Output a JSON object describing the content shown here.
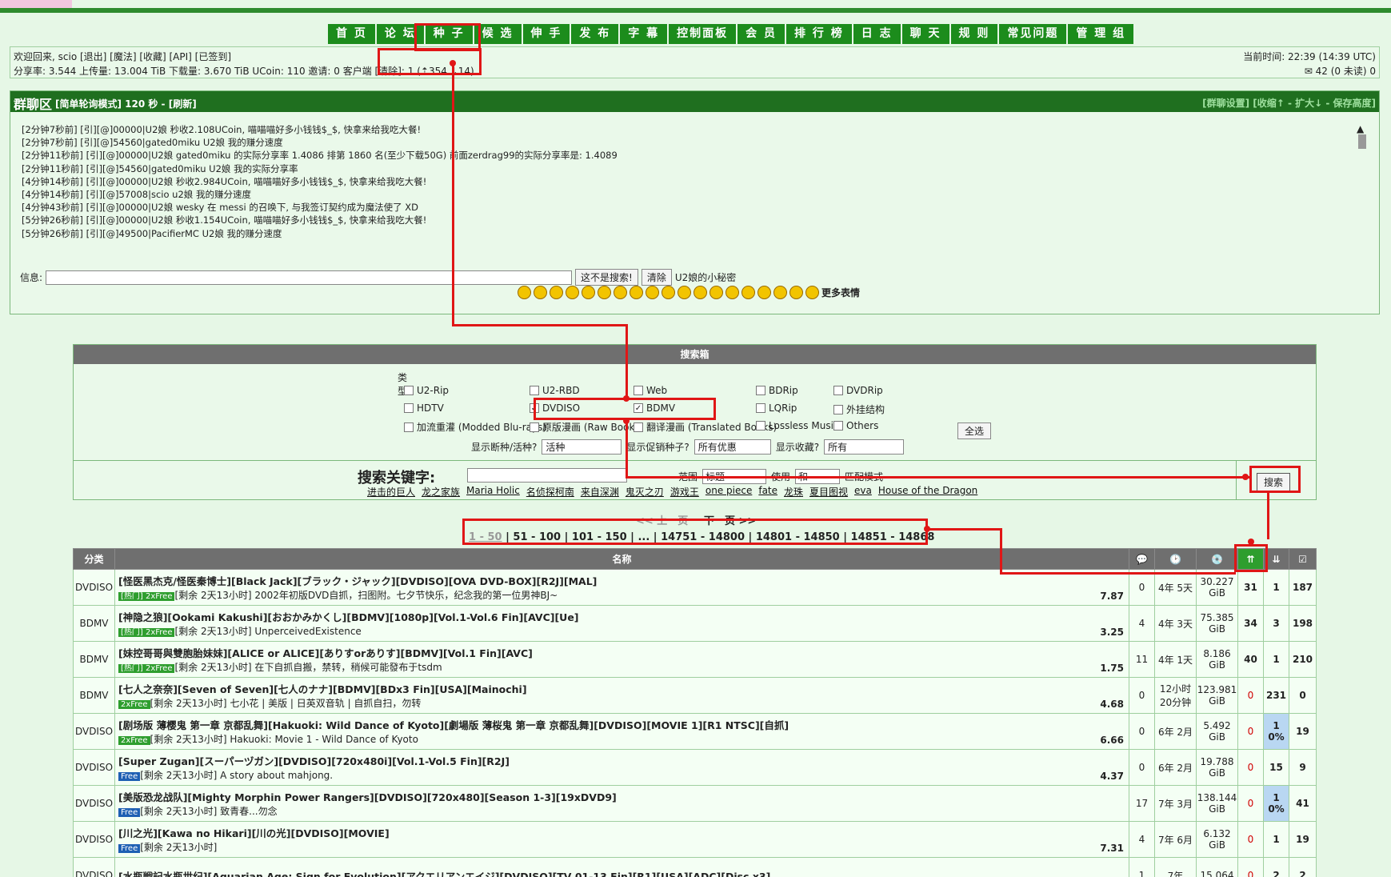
{
  "nav": [
    "首 页",
    "论 坛",
    "种 子",
    "候 选",
    "伸 手",
    "发 布",
    "字 幕",
    "控制面板",
    "会 员",
    "排 行 榜",
    "日 志",
    "聊 天",
    "规 则",
    "常见问题",
    "管 理 组"
  ],
  "userbar": {
    "line1": "欢迎回来, scio [退出] [魔法] [收藏] [API] [已签到]",
    "line2": "分享率: 3.544  上传量: 13.004 TiB  下载量: 3.670 TiB  UCoin: 110  邀请: 0  客户端 [清除]: 1 (⇡354 ⇣14)",
    "time": "当前时间: 22:39 (14:39 UTC)",
    "msgs": "42 (0 未读)  0"
  },
  "chat": {
    "title": "群聊区",
    "mode": "[简单轮询模式] 120 秒 - [刷新]",
    "right": "[群聊设置] [收缩↑ - 扩大↓ - 保存高度]",
    "messages": [
      "[2分钟7秒前] [引][@]00000|U2娘 秒收2.108UCoin, 喵喵喵好多小钱钱$_$, 快拿来给我吃大餐!",
      "[2分钟7秒前] [引][@]54560|gated0miku U2娘 我的赚分速度",
      "[2分钟11秒前] [引][@]00000|U2娘 gated0miku 的实际分享率 1.4086 排第 1860 名(至少下载50G)  前面zerdrag99的实际分享率是: 1.4089",
      "[2分钟11秒前] [引][@]54560|gated0miku U2娘 我的实际分享率",
      "[4分钟14秒前] [引][@]00000|U2娘 秒收2.984UCoin, 喵喵喵好多小钱钱$_$, 快拿来给我吃大餐!",
      "[4分钟14秒前] [引][@]57008|scio u2娘 我的赚分速度",
      "[4分钟43秒前] [引][@]00000|U2娘 wesky 在 messi 的召唤下, 与我签订契约成为魔法使了 XD",
      "[5分钟26秒前] [引][@]00000|U2娘 秒收1.154UCoin, 喵喵喵好多小钱钱$_$, 快拿来给我吃大餐!",
      "[5分钟26秒前] [引][@]49500|PacifierMC U2娘 我的赚分速度"
    ],
    "info_label": "信息:",
    "btn_not_search": "这不是搜索!",
    "btn_clear": "清除",
    "secret": "U2娘的小秘密",
    "more_emoji": "更多表情"
  },
  "search": {
    "header": "搜索箱",
    "type_label": "类型:",
    "types": [
      {
        "label": "U2-Rip",
        "checked": false
      },
      {
        "label": "U2-RBD",
        "checked": false
      },
      {
        "label": "Web",
        "checked": false
      },
      {
        "label": "BDRip",
        "checked": false
      },
      {
        "label": "DVDRip",
        "checked": false
      },
      {
        "label": "HDTV",
        "checked": false
      },
      {
        "label": "DVDISO",
        "checked": true
      },
      {
        "label": "BDMV",
        "checked": true
      },
      {
        "label": "LQRip",
        "checked": false
      },
      {
        "label": "外挂结构",
        "checked": false
      },
      {
        "label": "加流重灌 (Modded Blu-rays)",
        "checked": false
      },
      {
        "label": "原版漫画 (Raw Books)",
        "checked": false
      },
      {
        "label": "翻译漫画 (Translated Books)",
        "checked": false
      },
      {
        "label": "Lossless Music",
        "checked": false
      },
      {
        "label": "Others",
        "checked": false
      }
    ],
    "select_all": "全选",
    "show_dead": "显示断种/活种?",
    "dead_val": "活种",
    "show_promo": "显示促销种子?",
    "promo_val": "所有优惠",
    "show_fav": "显示收藏?",
    "fav_val": "所有",
    "keyword_label": "搜索关键字:",
    "range_label": "范围",
    "range_val": "标题",
    "use_label": "使用",
    "use_val": "和",
    "match_label": "匹配模式",
    "search_btn": "搜索",
    "hot": [
      "进击的巨人",
      "龙之家族",
      "Maria Holic",
      "名侦探柯南",
      "来自深渊",
      "鬼灭之刃",
      "游戏王",
      "one piece",
      "fate",
      "龙珠",
      "夏目图视",
      "eva",
      "House of the Dragon"
    ]
  },
  "pager": {
    "prev": "<< 上一页",
    "next": "下一页 >>",
    "pages": [
      "1 - 50",
      "51 - 100",
      "101 - 150",
      "...",
      "14751 - 14800",
      "14801 - 14850",
      "14851 - 14868"
    ]
  },
  "table": {
    "headers": [
      "分类",
      "名称"
    ],
    "rows": [
      {
        "cat": "DVDISO",
        "title": "[怪医黑杰克/怪医秦博士][Black Jack][ブラック・ジャック][DVDISO][OVA DVD-BOX][R2J][MAL]",
        "tags": "[热门] 2xFree",
        "sub": "[剩余 2天13小时] 2002年初版DVD自抓，扫图附。七夕节快乐，纪念我的第一位男神BJ~",
        "rating": "7.87",
        "comments": "0",
        "age": "4年 5天",
        "size": "30.227 GiB",
        "seed": "31",
        "leech": "1",
        "done": "187"
      },
      {
        "cat": "BDMV",
        "title": "[神隐之狼][Ookami Kakushi][おおかみかくし][BDMV][1080p][Vol.1-Vol.6 Fin][AVC][Ue]",
        "tags": "[热门] 2xFree",
        "sub": "[剩余 2天13小时] UnperceivedExistence",
        "rating": "3.25",
        "comments": "4",
        "age": "4年 3天",
        "size": "75.385 GiB",
        "seed": "34",
        "leech": "3",
        "done": "198"
      },
      {
        "cat": "BDMV",
        "title": "[妹控哥哥與雙胞胎妹妹][ALICE or ALICE][ありすorありす][BDMV][Vol.1 Fin][AVC]",
        "tags": "[热门] 2xFree",
        "sub": "[剩余 2天13小时] 在下自抓自搬，禁转，稍候可能發布于tsdm",
        "rating": "1.75",
        "comments": "11",
        "age": "4年 1天",
        "size": "8.186 GiB",
        "seed": "40",
        "leech": "1",
        "done": "210"
      },
      {
        "cat": "BDMV",
        "title": "[七人之奈奈][Seven of Seven][七人のナナ][BDMV][BDx3 Fin][USA][Mainochi]",
        "tags": "2xFree",
        "sub": "[剩余 2天13小时] 七小花 | 美版 | 日英双音轨 | 自抓自扫，勿转",
        "rating": "4.68",
        "comments": "0",
        "age": "12小时 20分钟",
        "size": "123.981 GiB",
        "seed": "0",
        "leech": "231",
        "done": "0"
      },
      {
        "cat": "DVDISO",
        "title": "[剧场版 薄樱鬼 第一章 京都乱舞][Hakuoki: Wild Dance of Kyoto][劇場版 薄桜鬼 第一章 京都乱舞][DVDISO][MOVIE 1][R1 NTSC][自抓]",
        "tags": "2xFree",
        "sub": "[剩余 2天13小时] Hakuoki: Movie 1 - Wild Dance of Kyoto",
        "rating": "6.66",
        "comments": "0",
        "age": "6年 2月",
        "size": "5.492 GiB",
        "seed": "0",
        "leech": "1 0%",
        "done": "19"
      },
      {
        "cat": "DVDISO",
        "title": "[Super Zugan][スーパーヅガン][DVDISO][720x480i][Vol.1-Vol.5 Fin][R2J]",
        "tags": "Free",
        "sub": "[剩余 2天13小时] A story about mahjong.",
        "rating": "4.37",
        "comments": "0",
        "age": "6年 2月",
        "size": "19.788 GiB",
        "seed": "0",
        "leech": "15",
        "done": "9"
      },
      {
        "cat": "DVDISO",
        "title": "[美版恐龙战队][Mighty Morphin Power Rangers][DVDISO][720x480][Season 1-3][19xDVD9]",
        "tags": "Free",
        "sub": "[剩余 2天13小时] 致青春...勿念",
        "rating": "",
        "comments": "17",
        "age": "7年 3月",
        "size": "138.144 GiB",
        "seed": "0",
        "leech": "1 0%",
        "done": "41"
      },
      {
        "cat": "DVDISO",
        "title": "[川之光][Kawa no Hikari][川の光][DVDISO][MOVIE]",
        "tags": "Free",
        "sub": "[剩余 2天13小时]",
        "rating": "7.31",
        "comments": "4",
        "age": "7年 6月",
        "size": "6.132 GiB",
        "seed": "0",
        "leech": "1",
        "done": "19"
      },
      {
        "cat": "DVDISO",
        "title": "[水瓶戦記水瓶世纪][Aquarian Age: Sign for Evolution][アクエリアンエイジ][DVDISO][TV 01-13 Fin][R1][USA][ADC][Disc x3]",
        "tags": "",
        "sub": "",
        "rating": "",
        "comments": "1",
        "age": "7年",
        "size": "15.064",
        "seed": "0",
        "leech": "2",
        "done": "2"
      }
    ]
  }
}
